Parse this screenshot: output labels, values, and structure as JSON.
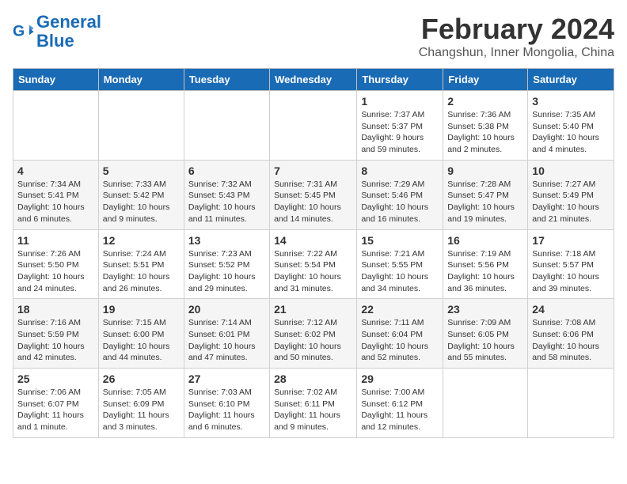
{
  "logo": {
    "line1": "General",
    "line2": "Blue"
  },
  "title": "February 2024",
  "subtitle": "Changshun, Inner Mongolia, China",
  "days_of_week": [
    "Sunday",
    "Monday",
    "Tuesday",
    "Wednesday",
    "Thursday",
    "Friday",
    "Saturday"
  ],
  "weeks": [
    [
      {
        "day": "",
        "content": ""
      },
      {
        "day": "",
        "content": ""
      },
      {
        "day": "",
        "content": ""
      },
      {
        "day": "",
        "content": ""
      },
      {
        "day": "1",
        "content": "Sunrise: 7:37 AM\nSunset: 5:37 PM\nDaylight: 9 hours and 59 minutes."
      },
      {
        "day": "2",
        "content": "Sunrise: 7:36 AM\nSunset: 5:38 PM\nDaylight: 10 hours and 2 minutes."
      },
      {
        "day": "3",
        "content": "Sunrise: 7:35 AM\nSunset: 5:40 PM\nDaylight: 10 hours and 4 minutes."
      }
    ],
    [
      {
        "day": "4",
        "content": "Sunrise: 7:34 AM\nSunset: 5:41 PM\nDaylight: 10 hours and 6 minutes."
      },
      {
        "day": "5",
        "content": "Sunrise: 7:33 AM\nSunset: 5:42 PM\nDaylight: 10 hours and 9 minutes."
      },
      {
        "day": "6",
        "content": "Sunrise: 7:32 AM\nSunset: 5:43 PM\nDaylight: 10 hours and 11 minutes."
      },
      {
        "day": "7",
        "content": "Sunrise: 7:31 AM\nSunset: 5:45 PM\nDaylight: 10 hours and 14 minutes."
      },
      {
        "day": "8",
        "content": "Sunrise: 7:29 AM\nSunset: 5:46 PM\nDaylight: 10 hours and 16 minutes."
      },
      {
        "day": "9",
        "content": "Sunrise: 7:28 AM\nSunset: 5:47 PM\nDaylight: 10 hours and 19 minutes."
      },
      {
        "day": "10",
        "content": "Sunrise: 7:27 AM\nSunset: 5:49 PM\nDaylight: 10 hours and 21 minutes."
      }
    ],
    [
      {
        "day": "11",
        "content": "Sunrise: 7:26 AM\nSunset: 5:50 PM\nDaylight: 10 hours and 24 minutes."
      },
      {
        "day": "12",
        "content": "Sunrise: 7:24 AM\nSunset: 5:51 PM\nDaylight: 10 hours and 26 minutes."
      },
      {
        "day": "13",
        "content": "Sunrise: 7:23 AM\nSunset: 5:52 PM\nDaylight: 10 hours and 29 minutes."
      },
      {
        "day": "14",
        "content": "Sunrise: 7:22 AM\nSunset: 5:54 PM\nDaylight: 10 hours and 31 minutes."
      },
      {
        "day": "15",
        "content": "Sunrise: 7:21 AM\nSunset: 5:55 PM\nDaylight: 10 hours and 34 minutes."
      },
      {
        "day": "16",
        "content": "Sunrise: 7:19 AM\nSunset: 5:56 PM\nDaylight: 10 hours and 36 minutes."
      },
      {
        "day": "17",
        "content": "Sunrise: 7:18 AM\nSunset: 5:57 PM\nDaylight: 10 hours and 39 minutes."
      }
    ],
    [
      {
        "day": "18",
        "content": "Sunrise: 7:16 AM\nSunset: 5:59 PM\nDaylight: 10 hours and 42 minutes."
      },
      {
        "day": "19",
        "content": "Sunrise: 7:15 AM\nSunset: 6:00 PM\nDaylight: 10 hours and 44 minutes."
      },
      {
        "day": "20",
        "content": "Sunrise: 7:14 AM\nSunset: 6:01 PM\nDaylight: 10 hours and 47 minutes."
      },
      {
        "day": "21",
        "content": "Sunrise: 7:12 AM\nSunset: 6:02 PM\nDaylight: 10 hours and 50 minutes."
      },
      {
        "day": "22",
        "content": "Sunrise: 7:11 AM\nSunset: 6:04 PM\nDaylight: 10 hours and 52 minutes."
      },
      {
        "day": "23",
        "content": "Sunrise: 7:09 AM\nSunset: 6:05 PM\nDaylight: 10 hours and 55 minutes."
      },
      {
        "day": "24",
        "content": "Sunrise: 7:08 AM\nSunset: 6:06 PM\nDaylight: 10 hours and 58 minutes."
      }
    ],
    [
      {
        "day": "25",
        "content": "Sunrise: 7:06 AM\nSunset: 6:07 PM\nDaylight: 11 hours and 1 minute."
      },
      {
        "day": "26",
        "content": "Sunrise: 7:05 AM\nSunset: 6:09 PM\nDaylight: 11 hours and 3 minutes."
      },
      {
        "day": "27",
        "content": "Sunrise: 7:03 AM\nSunset: 6:10 PM\nDaylight: 11 hours and 6 minutes."
      },
      {
        "day": "28",
        "content": "Sunrise: 7:02 AM\nSunset: 6:11 PM\nDaylight: 11 hours and 9 minutes."
      },
      {
        "day": "29",
        "content": "Sunrise: 7:00 AM\nSunset: 6:12 PM\nDaylight: 11 hours and 12 minutes."
      },
      {
        "day": "",
        "content": ""
      },
      {
        "day": "",
        "content": ""
      }
    ]
  ]
}
